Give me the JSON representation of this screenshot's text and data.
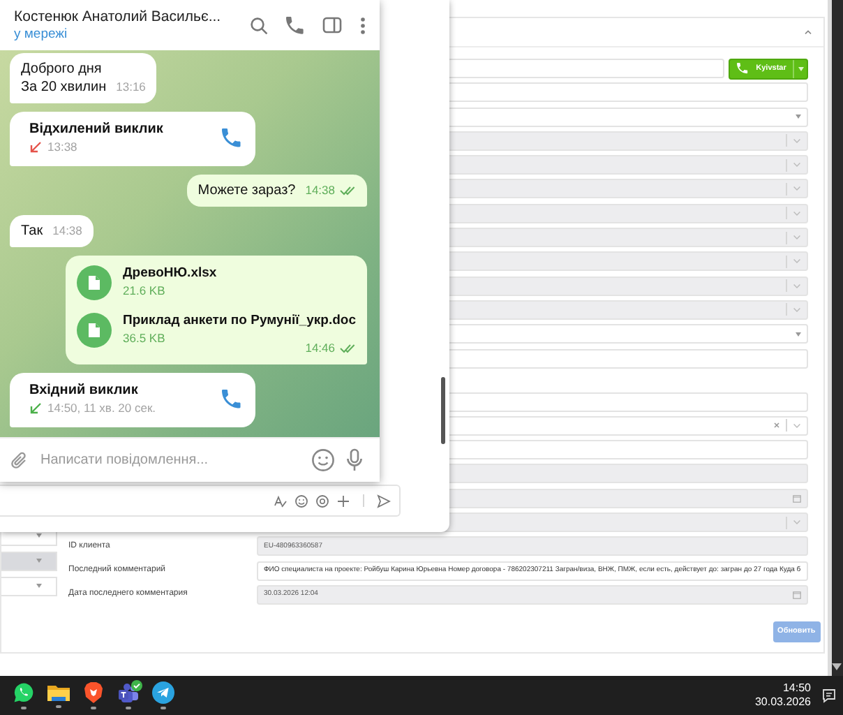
{
  "chat": {
    "contact_name": "Костенюк Анатолий Васильє...",
    "status": "у мережі",
    "messages": [
      {
        "kind": "text",
        "outgoing": false,
        "lines": [
          "Доброго дня",
          "За 20 хвилин"
        ],
        "time": "13:16"
      },
      {
        "kind": "call",
        "outgoing": false,
        "title": "Відхилений виклик",
        "detail": "13:38",
        "declined": true
      },
      {
        "kind": "text",
        "outgoing": true,
        "lines": [
          "Можете зараз?"
        ],
        "time": "14:38",
        "read": true
      },
      {
        "kind": "text",
        "outgoing": false,
        "lines": [
          "Так"
        ],
        "time": "14:38"
      },
      {
        "kind": "files",
        "outgoing": true,
        "files": [
          {
            "name": "ДревоНЮ.xlsx",
            "size": "21.6 KB"
          },
          {
            "name": "Приклад анкети по Румунії_укр.doc",
            "size": "36.5 KB"
          }
        ],
        "time": "14:46",
        "read": true
      },
      {
        "kind": "call",
        "outgoing": false,
        "title": "Вхідний виклик",
        "detail": "14:50, 11 хв. 20 сек.",
        "declined": false
      }
    ],
    "composer": {
      "placeholder": "Написати повідомлення..."
    }
  },
  "crm": {
    "call_button": {
      "label": "Kyivstar"
    },
    "side_selects": [
      {
        "disabled": false
      },
      {
        "disabled": true
      },
      {
        "disabled": false
      }
    ],
    "sections": [
      {
        "rows": [
          {
            "kind": "input-call"
          },
          {
            "kind": "input"
          },
          {
            "kind": "select"
          },
          {
            "kind": "disabled-select"
          },
          {
            "kind": "disabled-select"
          },
          {
            "kind": "disabled-select"
          },
          {
            "kind": "disabled-select"
          },
          {
            "kind": "disabled-select"
          },
          {
            "kind": "disabled-select"
          },
          {
            "kind": "disabled-select"
          },
          {
            "kind": "disabled-select"
          },
          {
            "kind": "select"
          },
          {
            "kind": "input"
          }
        ]
      },
      {
        "rows": [
          {
            "kind": "input"
          },
          {
            "kind": "clearable-select"
          },
          {
            "kind": "input"
          },
          {
            "kind": "disabled-input"
          },
          {
            "kind": "disabled-date"
          },
          {
            "kind": "disabled-select"
          },
          {
            "kind": "disabled-input",
            "label": "ID клиента",
            "value": "EU-480963360587"
          },
          {
            "kind": "input",
            "label": "Последний комментарий",
            "value": "ФИО специалиста на проекте: Ройбуш Карина Юрьевна   Номер договора - 786202307211 Загран/виза, ВНЖ, ПМЖ, если есть, действует до: загран до 27 года Куда б"
          },
          {
            "kind": "disabled-date",
            "label": "Дата последнего комментария",
            "value": "30.03.2026 12:04"
          }
        ]
      }
    ],
    "update_button": "Обновить"
  },
  "taskbar": {
    "apps": [
      {
        "kind": "chat",
        "running": true
      },
      {
        "kind": "files",
        "running": true
      },
      {
        "kind": "browser",
        "running": true
      },
      {
        "kind": "meetings",
        "running": true,
        "badge": true
      },
      {
        "kind": "messenger",
        "running": true
      }
    ],
    "time": "14:50",
    "date": "30.03.2026"
  }
}
